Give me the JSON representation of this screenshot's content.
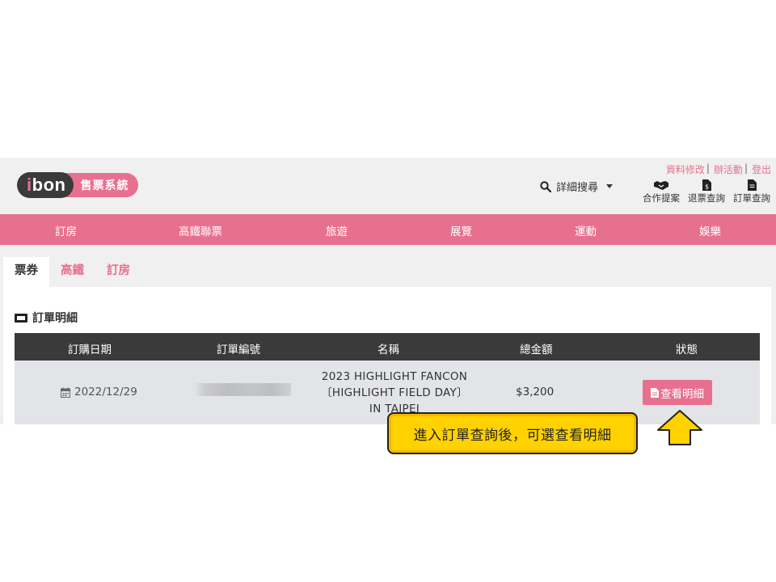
{
  "header": {
    "logo_main": "ibon",
    "logo_sub": "售票系統",
    "top_links": [
      "資料修改",
      "辦活動",
      "登出"
    ],
    "search_label": "詳細搜尋",
    "icon_links": [
      {
        "label": "合作提案",
        "icon": "handshake-icon"
      },
      {
        "label": "退票查詢",
        "icon": "refund-doc-icon"
      },
      {
        "label": "訂單查詢",
        "icon": "order-doc-icon"
      }
    ]
  },
  "nav": [
    "訂房",
    "高鐵聯票",
    "旅遊",
    "展覽",
    "運動",
    "娛樂"
  ],
  "tabs": [
    "票券",
    "高鐵",
    "訂房"
  ],
  "section_title": "訂單明細",
  "table": {
    "headers": [
      "訂購日期",
      "訂單編號",
      "名稱",
      "總金額",
      "狀態"
    ],
    "row": {
      "date": "2022/12/29",
      "order_no": "",
      "name_lines": [
        "2023 HIGHLIGHT FANCON",
        "〔HIGHLIGHT FIELD DAY〕",
        "IN TAIPEI"
      ],
      "amount": "$3,200",
      "action": "查看明細"
    }
  },
  "callout": "進入訂單查詢後，可選查看明細",
  "colors": {
    "brand_pink": "#e8708f",
    "dark": "#3a3a3a",
    "callout_yellow": "#ffd200"
  }
}
